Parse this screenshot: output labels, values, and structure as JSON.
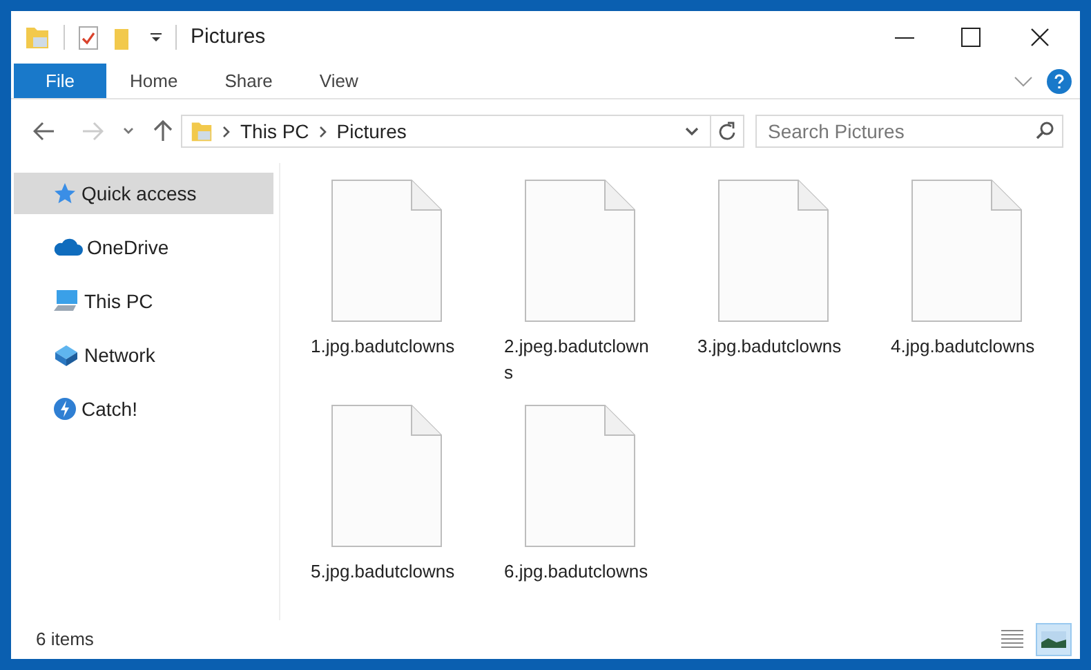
{
  "window": {
    "title": "Pictures"
  },
  "ribbon_tabs": [
    {
      "label": "File",
      "kind": "file"
    },
    {
      "label": "Home",
      "kind": "tab"
    },
    {
      "label": "Share",
      "kind": "tab"
    },
    {
      "label": "View",
      "kind": "tab"
    }
  ],
  "address_bar": {
    "path": [
      "This PC",
      "Pictures"
    ]
  },
  "search": {
    "placeholder": "Search Pictures"
  },
  "sidebar": {
    "items": [
      {
        "label": "Quick access",
        "kind": "star",
        "selected": true
      },
      {
        "label": "OneDrive",
        "kind": "cloud",
        "selected": false
      },
      {
        "label": "This PC",
        "kind": "pc",
        "selected": false
      },
      {
        "label": "Network",
        "kind": "network",
        "selected": false
      },
      {
        "label": "Catch!",
        "kind": "bolt",
        "selected": false
      }
    ]
  },
  "files": [
    {
      "name": "1.jpg.badutclowns"
    },
    {
      "name": "2.jpeg.badutclowns"
    },
    {
      "name": "3.jpg.badutclowns"
    },
    {
      "name": "4.jpg.badutclowns"
    },
    {
      "name": "5.jpg.badutclowns"
    },
    {
      "name": "6.jpg.badutclowns"
    }
  ],
  "status_bar": {
    "count": "6 items",
    "views": [
      {
        "kind": "details",
        "selected": false
      },
      {
        "kind": "large_icons",
        "selected": true
      }
    ]
  }
}
